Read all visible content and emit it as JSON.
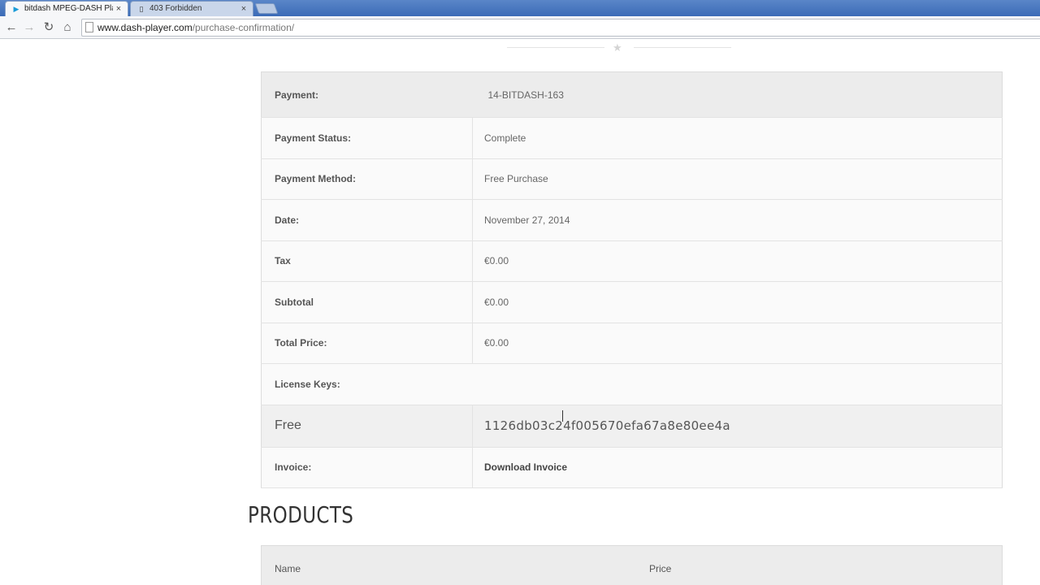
{
  "browser": {
    "tabs": [
      {
        "title": "bitdash MPEG-DASH Play",
        "active": true,
        "icon": "play-icon"
      },
      {
        "title": "403 Forbidden",
        "active": false,
        "icon": "page-icon"
      }
    ],
    "url_host": "www.dash-player.com",
    "url_path": "/purchase-confirmation/"
  },
  "receipt": {
    "header": {
      "label": "Payment:",
      "value": "14-BITDASH-163"
    },
    "rows": [
      {
        "label": "Payment Status:",
        "value": "Complete"
      },
      {
        "label": "Payment Method:",
        "value": "Free Purchase"
      },
      {
        "label": "Date:",
        "value": "November 27, 2014"
      },
      {
        "label": "Tax",
        "value": "€0.00"
      },
      {
        "label": "Subtotal",
        "value": "€0.00"
      },
      {
        "label": "Total Price:",
        "value": "€0.00"
      }
    ],
    "license_keys_label": "License Keys:",
    "license": {
      "name": "Free",
      "key": "1126db03c24f005670efa67a8e80ee4a"
    },
    "invoice": {
      "label": "Invoice:",
      "link": "Download Invoice"
    }
  },
  "products": {
    "title": "PRODUCTS",
    "columns": {
      "name": "Name",
      "price": "Price"
    }
  }
}
